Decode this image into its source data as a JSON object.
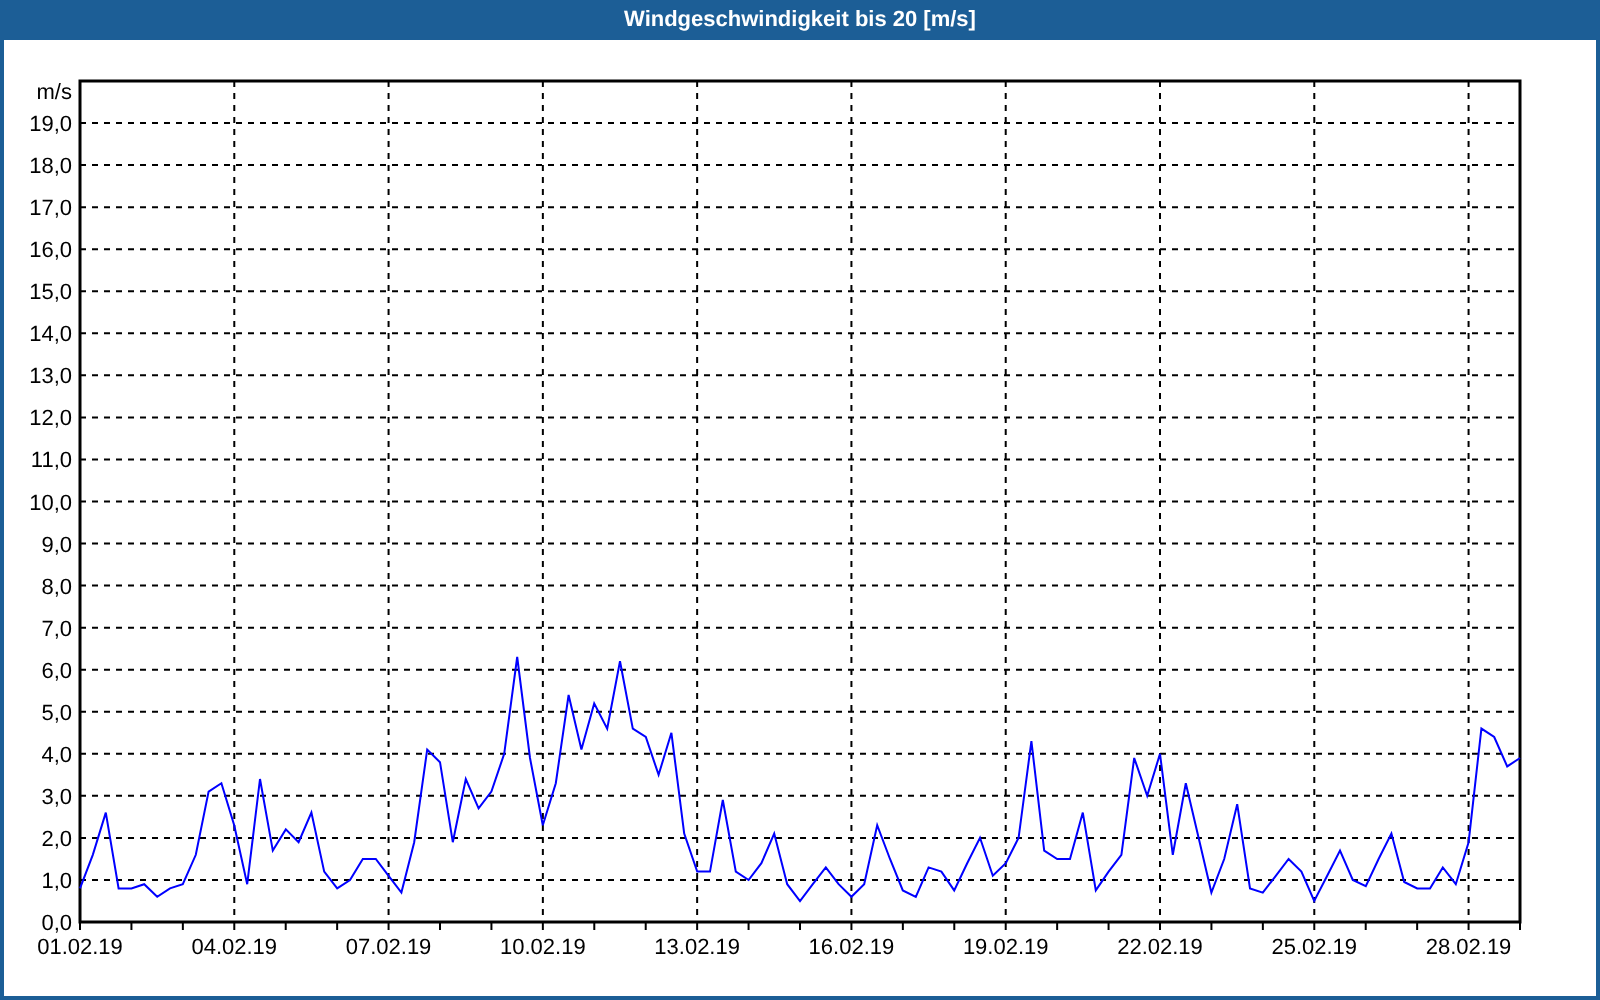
{
  "chart": {
    "chart_data": {
      "type": "line",
      "title": "Windgeschwindigkeit bis 20 [m/s]",
      "ylabel": "m/s",
      "grid": true,
      "ylim": [
        0,
        20
      ],
      "yticks": [
        {
          "value": 0,
          "label": "0,0"
        },
        {
          "value": 1,
          "label": "1,0"
        },
        {
          "value": 2,
          "label": "2,0"
        },
        {
          "value": 3,
          "label": "3,0"
        },
        {
          "value": 4,
          "label": "4,0"
        },
        {
          "value": 5,
          "label": "5,0"
        },
        {
          "value": 6,
          "label": "6,0"
        },
        {
          "value": 7,
          "label": "7,0"
        },
        {
          "value": 8,
          "label": "8,0"
        },
        {
          "value": 9,
          "label": "9,0"
        },
        {
          "value": 10,
          "label": "10,0"
        },
        {
          "value": 11,
          "label": "11,0"
        },
        {
          "value": 12,
          "label": "12,0"
        },
        {
          "value": 13,
          "label": "13,0"
        },
        {
          "value": 14,
          "label": "14,0"
        },
        {
          "value": 15,
          "label": "15,0"
        },
        {
          "value": 16,
          "label": "16,0"
        },
        {
          "value": 17,
          "label": "17,0"
        },
        {
          "value": 18,
          "label": "18,0"
        },
        {
          "value": 19,
          "label": "19,0"
        }
      ],
      "categories": [
        "01.02.19",
        null,
        null,
        null,
        null,
        null,
        null,
        null,
        null,
        null,
        null,
        null,
        "04.02.19",
        null,
        null,
        null,
        null,
        null,
        null,
        null,
        null,
        null,
        null,
        null,
        "07.02.19",
        null,
        null,
        null,
        null,
        null,
        null,
        null,
        null,
        null,
        null,
        null,
        "10.02.19",
        null,
        null,
        null,
        null,
        null,
        null,
        null,
        null,
        null,
        null,
        null,
        "13.02.19",
        null,
        null,
        null,
        null,
        null,
        null,
        null,
        null,
        null,
        null,
        null,
        "16.02.19",
        null,
        null,
        null,
        null,
        null,
        null,
        null,
        null,
        null,
        null,
        null,
        "19.02.19",
        null,
        null,
        null,
        null,
        null,
        null,
        null,
        null,
        null,
        null,
        null,
        "22.02.19",
        null,
        null,
        null,
        null,
        null,
        null,
        null,
        null,
        null,
        null,
        null,
        "25.02.19",
        null,
        null,
        null,
        null,
        null,
        null,
        null,
        null,
        null,
        null,
        null,
        "28.02.19",
        null,
        null,
        null,
        null
      ],
      "series": [
        {
          "color": "#0000ff",
          "values": [
            0.8,
            1.6,
            2.6,
            0.8,
            0.8,
            0.9,
            0.6,
            0.8,
            0.9,
            1.6,
            3.1,
            3.3,
            2.3,
            0.9,
            3.4,
            1.7,
            2.2,
            1.9,
            2.6,
            1.2,
            0.8,
            1.0,
            1.5,
            1.5,
            1.1,
            0.7,
            1.9,
            4.1,
            3.8,
            1.9,
            3.4,
            2.7,
            3.1,
            4.0,
            6.3,
            3.9,
            2.3,
            3.3,
            5.4,
            4.1,
            5.2,
            4.6,
            6.2,
            4.6,
            4.4,
            3.5,
            4.5,
            2.1,
            1.2,
            1.2,
            2.9,
            1.2,
            1.0,
            1.4,
            2.1,
            0.9,
            0.5,
            0.9,
            1.3,
            0.9,
            0.6,
            0.9,
            2.3,
            1.5,
            0.75,
            0.6,
            1.3,
            1.2,
            0.75,
            1.4,
            2.0,
            1.1,
            1.4,
            2.0,
            4.3,
            1.7,
            1.5,
            1.5,
            2.6,
            0.75,
            1.2,
            1.6,
            3.9,
            3.0,
            4.0,
            1.6,
            3.3,
            2.0,
            0.7,
            1.5,
            2.8,
            0.8,
            0.7,
            1.1,
            1.5,
            1.2,
            0.5,
            1.1,
            1.7,
            1.0,
            0.85,
            1.5,
            2.1,
            0.95,
            0.8,
            0.8,
            1.3,
            0.9,
            1.9,
            4.6,
            4.4,
            3.7,
            3.9
          ]
        }
      ]
    }
  }
}
